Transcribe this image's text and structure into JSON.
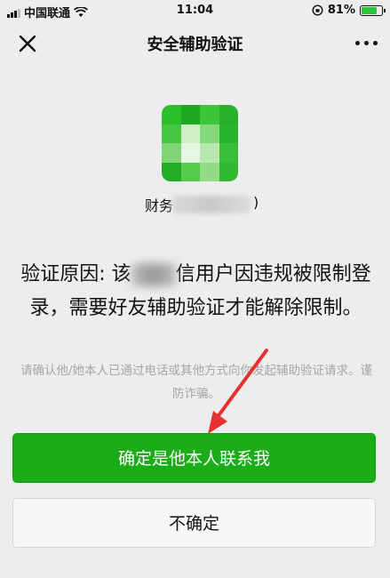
{
  "status_bar": {
    "carrier": "中国联通",
    "time": "11:04",
    "battery_percent": "81%",
    "battery_level": 0.81,
    "wifi_icon": "wifi-icon",
    "lock_icon": "orientation-lock-icon"
  },
  "nav": {
    "title": "安全辅助验证",
    "close_icon": "close-icon",
    "more_icon": "more-icon"
  },
  "profile": {
    "nickname_visible_start": "财务",
    "nickname_visible_end": ")"
  },
  "message": {
    "reason_prefix": "验证原因: 该",
    "reason_partial": "信",
    "reason_rest": "用户因违规被限制登录，需要好友辅助验证才能解除限制。",
    "hint": "请确认他/她本人已通过电话或其他方式向你发起辅助验证请求。谨防诈骗。"
  },
  "buttons": {
    "confirm_label": "确定是他本人联系我",
    "not_sure_label": "不确定"
  },
  "colors": {
    "accent_green": "#1aad19",
    "background": "#ededed",
    "arrow_red": "#e8312e"
  }
}
